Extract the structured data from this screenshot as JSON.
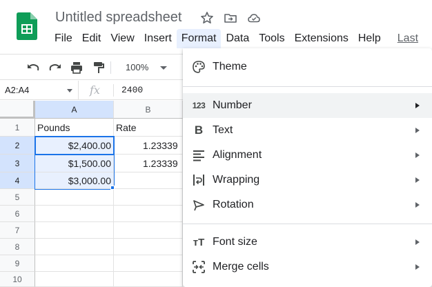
{
  "document": {
    "title": "Untitled spreadsheet"
  },
  "menubar": {
    "items": [
      "File",
      "Edit",
      "View",
      "Insert",
      "Format",
      "Data",
      "Tools",
      "Extensions",
      "Help"
    ],
    "active": "Format",
    "last_edit": "Last"
  },
  "toolbar": {
    "zoom": "100%"
  },
  "formula_bar": {
    "name_box": "A2:A4",
    "fx_label": "fx",
    "value": "2400"
  },
  "grid": {
    "columns": [
      "A",
      "B"
    ],
    "rows": [
      "1",
      "2",
      "3",
      "4",
      "5",
      "6",
      "7",
      "8",
      "9",
      "10"
    ],
    "cells": {
      "A1": "Pounds",
      "B1": "Rate",
      "A2": "$2,400.00",
      "B2": "1.23339",
      "A3": "$1,500.00",
      "B3": "1.23339",
      "A4": "$3,000.00"
    },
    "selected_range": "A2:A4"
  },
  "format_menu": {
    "items": [
      {
        "label": "Theme",
        "icon": "palette-icon",
        "submenu": false
      },
      {
        "label": "Number",
        "icon": "number-format-icon",
        "icon_text": "123",
        "submenu": true
      },
      {
        "label": "Text",
        "icon": "bold-icon",
        "icon_text": "B",
        "submenu": true
      },
      {
        "label": "Alignment",
        "icon": "align-left-icon",
        "submenu": true
      },
      {
        "label": "Wrapping",
        "icon": "text-wrap-icon",
        "submenu": true
      },
      {
        "label": "Rotation",
        "icon": "text-rotation-icon",
        "submenu": true
      },
      {
        "label": "Font size",
        "icon": "font-size-icon",
        "icon_text": "тT",
        "submenu": true
      },
      {
        "label": "Merge cells",
        "icon": "merge-cells-icon",
        "submenu": true
      }
    ],
    "hovered": "Number"
  },
  "colors": {
    "accent": "#1a73e8",
    "selection_fill": "#e8f0fe",
    "sheets_green": "#0f9d58"
  }
}
